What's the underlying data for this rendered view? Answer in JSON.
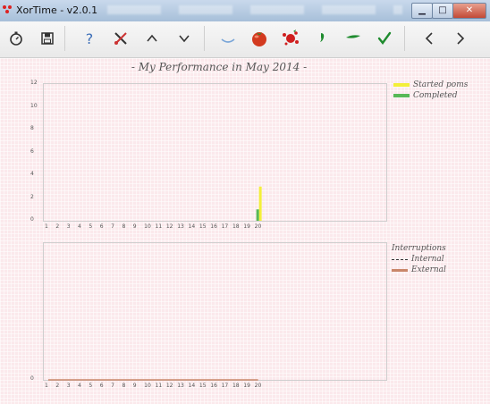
{
  "window": {
    "title": "XorTime - v2.0.1",
    "minimize": "▁",
    "maximize": "□",
    "close": "✕"
  },
  "toolbar": {
    "buttons": [
      {
        "name": "timer",
        "glyph": "⏱"
      },
      {
        "name": "save",
        "glyph": "💾"
      },
      {
        "name": "help",
        "glyph": "?"
      },
      {
        "name": "settings-tools",
        "glyph": "✂"
      },
      {
        "name": "up",
        "glyph": "∧"
      },
      {
        "name": "down",
        "glyph": "∨"
      },
      {
        "name": "hide",
        "glyph": "‿"
      },
      {
        "name": "tomato",
        "glyph": "●"
      },
      {
        "name": "splat",
        "glyph": "✱"
      },
      {
        "name": "internal-interruption",
        "glyph": "❜"
      },
      {
        "name": "external-interruption",
        "glyph": "▬"
      },
      {
        "name": "complete",
        "glyph": "✓"
      },
      {
        "name": "previous",
        "glyph": "<"
      },
      {
        "name": "next",
        "glyph": ">"
      }
    ],
    "colors": {
      "tomato": "#d33a1f",
      "splat": "#d01f1f",
      "green": "#1e8b2e"
    }
  },
  "chart_data": [
    {
      "type": "bar",
      "title": "- My Performance in May 2014 -",
      "categories": [
        "1",
        "2",
        "3",
        "4",
        "5",
        "6",
        "7",
        "8",
        "9",
        "10",
        "11",
        "12",
        "13",
        "14",
        "15",
        "16",
        "17",
        "18",
        "19",
        "20"
      ],
      "y_ticks": [
        "0",
        "2",
        "4",
        "6",
        "8",
        "10",
        "12"
      ],
      "ylim": [
        0,
        12
      ],
      "series": [
        {
          "name": "Started poms",
          "color": "#f3ef3a",
          "values": [
            0,
            0,
            0,
            0,
            0,
            0,
            0,
            0,
            0,
            0,
            0,
            0,
            0,
            0,
            0,
            0,
            0,
            0,
            0,
            3
          ]
        },
        {
          "name": "Completed",
          "color": "#58b957",
          "values": [
            0,
            0,
            0,
            0,
            0,
            0,
            0,
            0,
            0,
            0,
            0,
            0,
            0,
            0,
            0,
            0,
            0,
            0,
            0,
            1
          ]
        }
      ],
      "legend": "top-right"
    },
    {
      "type": "line",
      "title": "",
      "categories": [
        "1",
        "2",
        "3",
        "4",
        "5",
        "6",
        "7",
        "8",
        "9",
        "10",
        "11",
        "12",
        "13",
        "14",
        "15",
        "16",
        "17",
        "18",
        "19",
        "20"
      ],
      "y_ticks": [
        "0"
      ],
      "legend_title": "Interruptions",
      "series": [
        {
          "name": "Internal",
          "color": "#333333",
          "style": "dashed",
          "values": [
            0,
            0,
            0,
            0,
            0,
            0,
            0,
            0,
            0,
            0,
            0,
            0,
            0,
            0,
            0,
            0,
            0,
            0,
            0,
            0
          ]
        },
        {
          "name": "External",
          "color": "#c9876a",
          "style": "solid",
          "values": [
            0,
            0,
            0,
            0,
            0,
            0,
            0,
            0,
            0,
            0,
            0,
            0,
            0,
            0,
            0,
            0,
            0,
            0,
            0,
            0
          ]
        }
      ],
      "legend": "top-right"
    }
  ]
}
